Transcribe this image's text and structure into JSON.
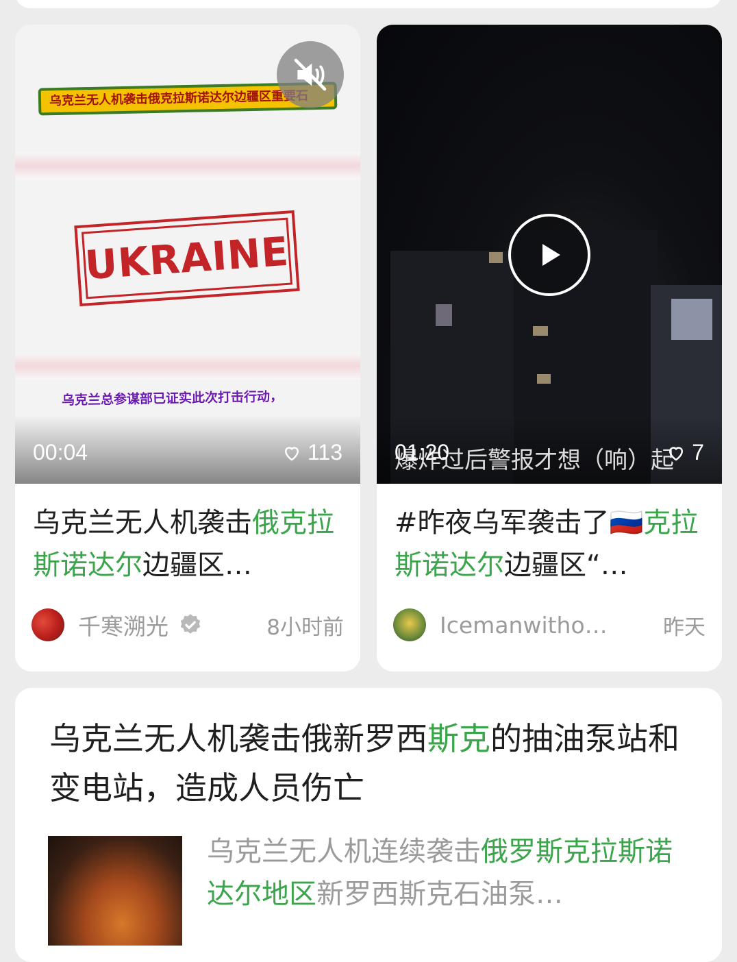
{
  "feed": {
    "cards": [
      {
        "cover": {
          "banner_text": "乌克兰无人机袭击俄克拉斯诺达尔边疆区重要石",
          "stamp_text": "UKRAINE",
          "caption": "乌克兰总参谋部已证实此次打击行动，",
          "mute_icon": "mute-icon"
        },
        "duration": "00:04",
        "likes": "113",
        "title_plain": "乌克兰无人机袭击",
        "title_highlight": "俄克拉斯诺达尔",
        "title_rest": "边疆区…",
        "author": "千寒溯光",
        "verified_icon": "verified-badge-icon",
        "time": "8小时前"
      },
      {
        "cover": {
          "play_icon": "play-icon",
          "caption": "爆炸过后警报才想（响）起"
        },
        "duration": "01:20",
        "likes": "7",
        "title_plain": "#昨夜乌军袭击了🇷🇺",
        "title_highlight": "克拉斯诺达尔",
        "title_rest": "边疆区“…",
        "author": "Icemanwitho…",
        "time": "昨天"
      }
    ],
    "article": {
      "title_a": "乌克兰无人机袭击俄新罗西",
      "title_highlight": "斯克",
      "title_b": "的抽油泵站和变电站，造成人员伤亡",
      "summary_a": "乌克兰无人机连续袭击",
      "summary_highlight": "俄罗斯克拉斯诺达尔地区",
      "summary_b": "新罗西斯克石油泵…"
    }
  },
  "colors": {
    "highlight": "#3aa54a",
    "meta_gray": "#9b9b9b",
    "background": "#ececec"
  }
}
